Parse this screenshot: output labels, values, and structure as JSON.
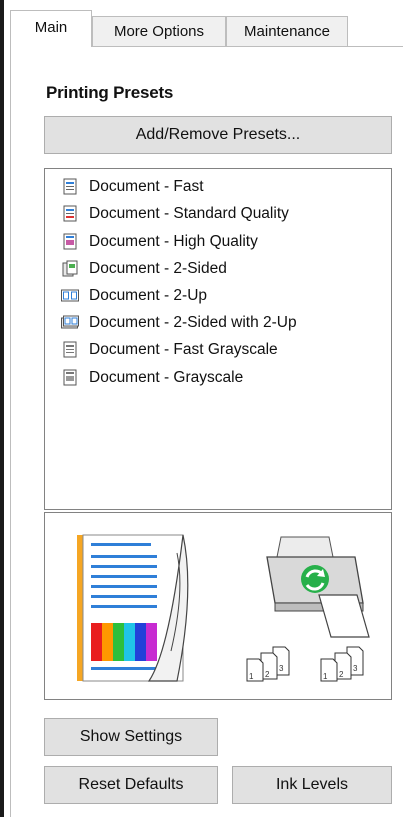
{
  "tabs": [
    {
      "label": "Main",
      "active": true
    },
    {
      "label": "More Options",
      "active": false
    },
    {
      "label": "Maintenance",
      "active": false
    }
  ],
  "printing_presets": {
    "title": "Printing Presets",
    "add_remove_button": "Add/Remove Presets...",
    "items": [
      {
        "label": "Document - Fast",
        "icon": "document-fast-icon"
      },
      {
        "label": "Document - Standard Quality",
        "icon": "document-standard-icon"
      },
      {
        "label": "Document - High Quality",
        "icon": "document-high-quality-icon"
      },
      {
        "label": "Document - 2-Sided",
        "icon": "document-2-sided-icon"
      },
      {
        "label": "Document - 2-Up",
        "icon": "document-2-up-icon"
      },
      {
        "label": "Document - 2-Sided with 2-Up",
        "icon": "document-2-sided-2-up-icon"
      },
      {
        "label": "Document - Fast Grayscale",
        "icon": "document-fast-grayscale-icon"
      },
      {
        "label": "Document - Grayscale",
        "icon": "document-grayscale-icon"
      }
    ]
  },
  "preview": {
    "page_icon": "page-preview-icon",
    "printer_icon": "printer-icon",
    "copies_icons": [
      "copies-icon",
      "copies-icon"
    ],
    "copies_labels": [
      "1",
      "2",
      "3"
    ]
  },
  "buttons": {
    "show_settings": "Show Settings",
    "reset_defaults": "Reset Defaults",
    "ink_levels": "Ink Levels"
  },
  "colors": {
    "accent_orange": "#f5a623",
    "line_blue": "#2f7fd8",
    "printer_green": "#27b04a"
  }
}
